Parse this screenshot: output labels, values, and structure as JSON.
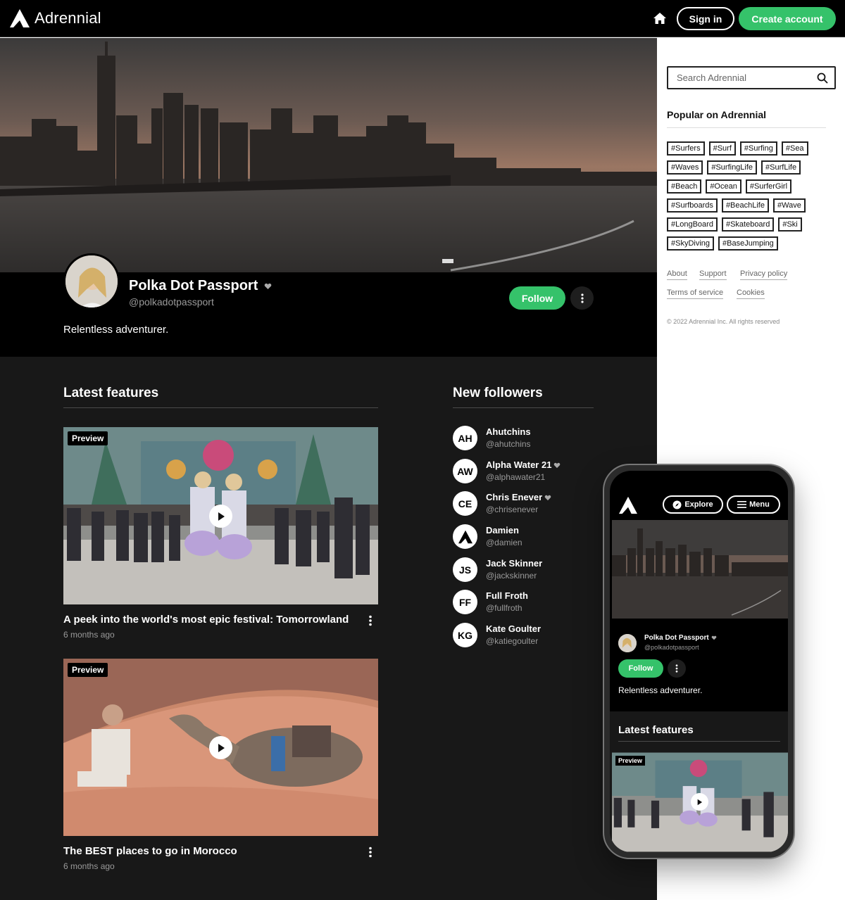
{
  "header": {
    "brand": "Adrennial",
    "sign_in": "Sign in",
    "create_account": "Create account"
  },
  "profile": {
    "name": "Polka Dot Passport",
    "handle": "@polkadotpassport",
    "bio": "Relentless adventurer.",
    "follow": "Follow"
  },
  "latest": {
    "title": "Latest features",
    "items": [
      {
        "badge": "Preview",
        "title": "A peek into the world's most epic festival: Tomorrowland",
        "time": "6 months ago"
      },
      {
        "badge": "Preview",
        "title": "The BEST places to go in Morocco",
        "time": "6 months ago"
      }
    ]
  },
  "followers": {
    "title": "New followers",
    "items": [
      {
        "initials": "AH",
        "name": "Ahutchins",
        "handle": "@ahutchins"
      },
      {
        "initials": "AW",
        "name": "Alpha Water 21",
        "handle": "@alphawater21"
      },
      {
        "initials": "CE",
        "name": "Chris Enever",
        "handle": "@chrisenever"
      },
      {
        "initials": "",
        "name": "Damien",
        "handle": "@damien"
      },
      {
        "initials": "JS",
        "name": "Jack Skinner",
        "handle": "@jackskinner"
      },
      {
        "initials": "FF",
        "name": "Full Froth",
        "handle": "@fullfroth"
      },
      {
        "initials": "KG",
        "name": "Kate Goulter",
        "handle": "@katiegoulter"
      }
    ]
  },
  "sidebar": {
    "search_placeholder": "Search Adrennial",
    "popular_title": "Popular on Adrennial",
    "tags": [
      [
        "#Surfers",
        "#Surf",
        "#Surfing",
        "#Sea"
      ],
      [
        "#Waves",
        "#SurfingLife",
        "#SurfLife"
      ],
      [
        "#Beach",
        "#Ocean",
        "#SurferGirl"
      ],
      [
        "#Surfboards",
        "#BeachLife",
        "#Wave"
      ],
      [
        "#LongBoard",
        "#Skateboard",
        "#Ski"
      ],
      [
        "#SkyDiving",
        "#BaseJumping"
      ]
    ],
    "links": [
      "About",
      "Support",
      "Privacy policy",
      "Terms of service",
      "Cookies"
    ],
    "copyright": "© 2022 Adrennial Inc. All rights reserved"
  },
  "phone": {
    "explore": "Explore",
    "menu": "Menu",
    "name": "Polka Dot Passport",
    "handle": "@polkadotpassport",
    "follow": "Follow",
    "bio": "Relentless adventurer.",
    "section": "Latest features",
    "badge": "Preview"
  },
  "colors": {
    "accent": "#35c26a",
    "dark": "#181818",
    "black": "#000000"
  }
}
